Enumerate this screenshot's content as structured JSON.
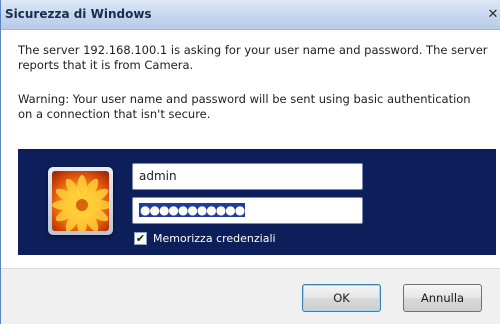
{
  "window": {
    "title": "Sicurezza di Windows",
    "close_glyph": "✕"
  },
  "message": {
    "server_line": "The server 192.168.100.1 is asking for your user name and password. The server reports that it is from Camera.",
    "warning_line": "Warning: Your user name and password will be sent using basic authentication on a connection that isn't secure."
  },
  "credentials": {
    "avatar_icon": "user-flower-avatar-icon",
    "username_value": "admin",
    "password_mask": "●●●●●●●●●●●",
    "remember_checked": true,
    "remember_check_glyph": "✔",
    "remember_label": "Memorizza credenziali"
  },
  "buttons": {
    "ok_label": "OK",
    "cancel_label": "Annulla"
  },
  "colors": {
    "panel_bg": "#0d1f5a",
    "title_gradient_top": "#dfe9f6",
    "selection_highlight": "#1e3e9a"
  }
}
